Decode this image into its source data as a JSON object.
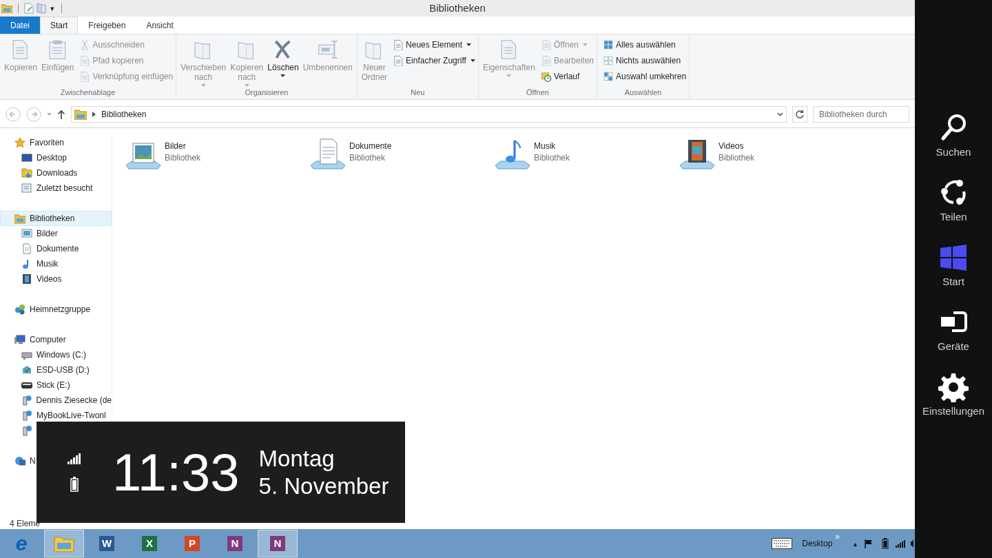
{
  "window": {
    "title": "Bibliotheken"
  },
  "quick_access": {
    "menu_glyph": "▾"
  },
  "ribbon_tabs": [
    {
      "label": "Datei",
      "kind": "file",
      "selected": false
    },
    {
      "label": "Start",
      "kind": "tab",
      "selected": true
    },
    {
      "label": "Freigeben",
      "kind": "tab",
      "selected": false
    },
    {
      "label": "Ansicht",
      "kind": "tab",
      "selected": false
    }
  ],
  "ribbon_groups": [
    {
      "label": "Zwischenablage",
      "large": [
        {
          "lines": [
            "Kopieren"
          ],
          "disabled": true,
          "dropdown": false
        },
        {
          "lines": [
            "Einfügen"
          ],
          "disabled": true,
          "dropdown": false
        }
      ],
      "small": [
        {
          "label": "Ausschneiden",
          "disabled": true,
          "dropdown": false
        },
        {
          "label": "Pfad kopieren",
          "disabled": true,
          "dropdown": false
        },
        {
          "label": "Verknüpfung einfügen",
          "disabled": true,
          "dropdown": false
        }
      ]
    },
    {
      "label": "Organisieren",
      "large": [
        {
          "lines": [
            "Verschieben",
            "nach"
          ],
          "disabled": true,
          "dropdown": true
        },
        {
          "lines": [
            "Kopieren",
            "nach"
          ],
          "disabled": true,
          "dropdown": true
        },
        {
          "lines": [
            "Löschen"
          ],
          "disabled": false,
          "dropdown": true
        },
        {
          "lines": [
            "Umbenennen"
          ],
          "disabled": true,
          "dropdown": false
        }
      ]
    },
    {
      "label": "Neu",
      "large": [
        {
          "lines": [
            "Neuer",
            "Ordner"
          ],
          "disabled": true,
          "dropdown": false
        }
      ],
      "small": [
        {
          "label": "Neues Element",
          "disabled": false,
          "dropdown": true
        },
        {
          "label": "Einfacher Zugriff",
          "disabled": false,
          "dropdown": true
        }
      ]
    },
    {
      "label": "Öffnen",
      "large": [
        {
          "lines": [
            "Eigenschaften"
          ],
          "disabled": true,
          "dropdown": true
        }
      ],
      "small": [
        {
          "label": "Öffnen",
          "disabled": true,
          "dropdown": true
        },
        {
          "label": "Bearbeiten",
          "disabled": true,
          "dropdown": false
        },
        {
          "label": "Verlauf",
          "disabled": false,
          "dropdown": false
        }
      ]
    },
    {
      "label": "Auswählen",
      "small": [
        {
          "label": "Alles auswählen",
          "disabled": false,
          "dropdown": false
        },
        {
          "label": "Nichts auswählen",
          "disabled": false,
          "dropdown": false
        },
        {
          "label": "Auswahl umkehren",
          "disabled": false,
          "dropdown": false
        }
      ]
    }
  ],
  "address_bar": {
    "path": "Bibliotheken",
    "search_placeholder": "Bibliotheken durch"
  },
  "navigation": [
    {
      "label": "Favoriten",
      "selected": false,
      "children": [
        {
          "label": "Desktop",
          "selected": false
        },
        {
          "label": "Downloads",
          "selected": false
        },
        {
          "label": "Zuletzt besucht",
          "selected": false
        }
      ]
    },
    {
      "label": "Bibliotheken",
      "selected": true,
      "children": [
        {
          "label": "Bilder",
          "selected": false
        },
        {
          "label": "Dokumente",
          "selected": false
        },
        {
          "label": "Musik",
          "selected": false
        },
        {
          "label": "Videos",
          "selected": false
        }
      ]
    },
    {
      "label": "Heimnetzgruppe",
      "selected": false
    },
    {
      "label": "Computer",
      "selected": false,
      "children": [
        {
          "label": "Windows (C:)",
          "selected": false
        },
        {
          "label": "ESD-USB (D:)",
          "selected": false
        },
        {
          "label": "Stick (E:)",
          "selected": false
        },
        {
          "label": "Dennis Ziesecke (de",
          "selected": false
        },
        {
          "label": "MyBookLive-Twonl",
          "selected": false
        },
        {
          "selected": false
        }
      ]
    },
    {
      "label": "N",
      "selected": false
    }
  ],
  "libraries": [
    {
      "name": "Bilder",
      "type": "Bibliothek"
    },
    {
      "name": "Dokumente",
      "type": "Bibliothek"
    },
    {
      "name": "Musik",
      "type": "Bibliothek"
    },
    {
      "name": "Videos",
      "type": "Bibliothek"
    }
  ],
  "status_bar": {
    "count": "4 Eleme"
  },
  "clock_overlay": {
    "time": "11:33",
    "weekday": "Montag",
    "date": "5. November"
  },
  "taskbar": {
    "apps": [
      {
        "glyph": "e",
        "color": "#0b5fb0",
        "selected": false
      },
      {
        "selected": true
      },
      {
        "glyph": "W",
        "color": "#2b5797",
        "selected": false
      },
      {
        "glyph": "X",
        "color": "#1e7145",
        "selected": false
      },
      {
        "glyph": "P",
        "color": "#d24726",
        "selected": false
      },
      {
        "glyph": "N",
        "color": "#80397b",
        "selected": false
      },
      {
        "glyph": "N",
        "color": "#80397b",
        "selected": true
      }
    ],
    "tray": {
      "desktop_label": "Desktop",
      "overflow_glyph": "»",
      "up_glyph": "▴"
    }
  },
  "charms": [
    {
      "label": "Suchen"
    },
    {
      "label": "Teilen"
    },
    {
      "label": "Start"
    },
    {
      "label": "Geräte"
    },
    {
      "label": "Einstellungen"
    }
  ]
}
